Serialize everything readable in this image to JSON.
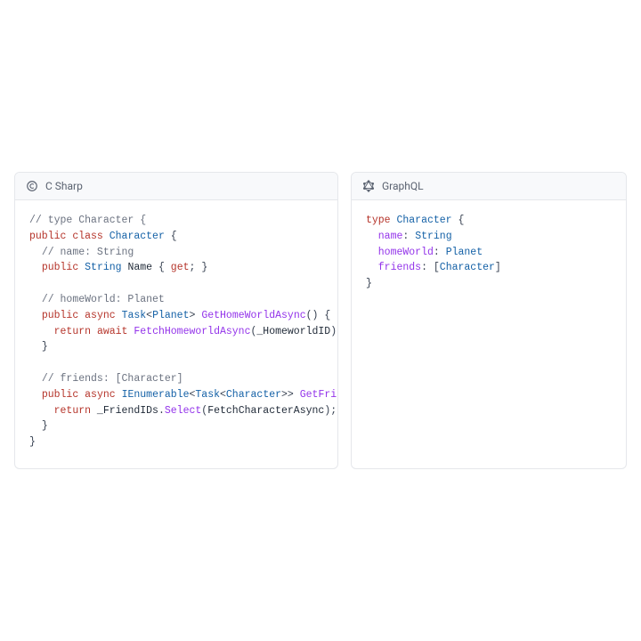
{
  "panels": {
    "left": {
      "title": "C Sharp",
      "icon": "csharp-icon",
      "code": [
        {
          "indent": 0,
          "tokens": [
            {
              "t": "comment",
              "v": "// type Character {"
            }
          ]
        },
        {
          "indent": 0,
          "tokens": [
            {
              "t": "keyword",
              "v": "public"
            },
            {
              "t": "space"
            },
            {
              "t": "keyword",
              "v": "class"
            },
            {
              "t": "space"
            },
            {
              "t": "type",
              "v": "Character"
            },
            {
              "t": "space"
            },
            {
              "t": "punc",
              "v": "{"
            }
          ]
        },
        {
          "indent": 1,
          "tokens": [
            {
              "t": "comment",
              "v": "// name: String"
            }
          ]
        },
        {
          "indent": 1,
          "tokens": [
            {
              "t": "keyword",
              "v": "public"
            },
            {
              "t": "space"
            },
            {
              "t": "type",
              "v": "String"
            },
            {
              "t": "space"
            },
            {
              "t": "plain",
              "v": "Name"
            },
            {
              "t": "space"
            },
            {
              "t": "punc",
              "v": "{"
            },
            {
              "t": "space"
            },
            {
              "t": "keyword",
              "v": "get"
            },
            {
              "t": "punc",
              "v": ";"
            },
            {
              "t": "space"
            },
            {
              "t": "punc",
              "v": "}"
            }
          ]
        },
        {
          "indent": 0,
          "tokens": []
        },
        {
          "indent": 1,
          "tokens": [
            {
              "t": "comment",
              "v": "// homeWorld: Planet"
            }
          ]
        },
        {
          "indent": 1,
          "tokens": [
            {
              "t": "keyword",
              "v": "public"
            },
            {
              "t": "space"
            },
            {
              "t": "keyword",
              "v": "async"
            },
            {
              "t": "space"
            },
            {
              "t": "type",
              "v": "Task"
            },
            {
              "t": "punc",
              "v": "<"
            },
            {
              "t": "type",
              "v": "Planet"
            },
            {
              "t": "punc",
              "v": ">"
            },
            {
              "t": "space"
            },
            {
              "t": "func",
              "v": "GetHomeWorldAsync"
            },
            {
              "t": "punc",
              "v": "()"
            },
            {
              "t": "space"
            },
            {
              "t": "punc",
              "v": "{"
            }
          ]
        },
        {
          "indent": 2,
          "tokens": [
            {
              "t": "keyword",
              "v": "return"
            },
            {
              "t": "space"
            },
            {
              "t": "keyword",
              "v": "await"
            },
            {
              "t": "space"
            },
            {
              "t": "func",
              "v": "FetchHomeworldAsync"
            },
            {
              "t": "punc",
              "v": "("
            },
            {
              "t": "plain",
              "v": "_HomeworldID"
            },
            {
              "t": "punc",
              "v": ")"
            }
          ]
        },
        {
          "indent": 1,
          "tokens": [
            {
              "t": "punc",
              "v": "}"
            }
          ]
        },
        {
          "indent": 0,
          "tokens": []
        },
        {
          "indent": 1,
          "tokens": [
            {
              "t": "comment",
              "v": "// friends: [Character]"
            }
          ]
        },
        {
          "indent": 1,
          "tokens": [
            {
              "t": "keyword",
              "v": "public"
            },
            {
              "t": "space"
            },
            {
              "t": "keyword",
              "v": "async"
            },
            {
              "t": "space"
            },
            {
              "t": "type",
              "v": "IEnumerable"
            },
            {
              "t": "punc",
              "v": "<"
            },
            {
              "t": "type",
              "v": "Task"
            },
            {
              "t": "punc",
              "v": "<"
            },
            {
              "t": "type",
              "v": "Character"
            },
            {
              "t": "punc",
              "v": ">>"
            },
            {
              "t": "space"
            },
            {
              "t": "func",
              "v": "GetFri"
            }
          ]
        },
        {
          "indent": 2,
          "tokens": [
            {
              "t": "keyword",
              "v": "return"
            },
            {
              "t": "space"
            },
            {
              "t": "plain",
              "v": "_FriendIDs"
            },
            {
              "t": "punc",
              "v": "."
            },
            {
              "t": "func",
              "v": "Select"
            },
            {
              "t": "punc",
              "v": "("
            },
            {
              "t": "plain",
              "v": "FetchCharacterAsync"
            },
            {
              "t": "punc",
              "v": ");"
            }
          ]
        },
        {
          "indent": 1,
          "tokens": [
            {
              "t": "punc",
              "v": "}"
            }
          ]
        },
        {
          "indent": 0,
          "tokens": [
            {
              "t": "punc",
              "v": "}"
            }
          ]
        }
      ]
    },
    "right": {
      "title": "GraphQL",
      "icon": "graphql-icon",
      "code": [
        {
          "indent": 0,
          "tokens": [
            {
              "t": "keyword",
              "v": "type"
            },
            {
              "t": "space"
            },
            {
              "t": "type",
              "v": "Character"
            },
            {
              "t": "space"
            },
            {
              "t": "punc",
              "v": "{"
            }
          ]
        },
        {
          "indent": 1,
          "tokens": [
            {
              "t": "field",
              "v": "name"
            },
            {
              "t": "punc",
              "v": ":"
            },
            {
              "t": "space"
            },
            {
              "t": "type",
              "v": "String"
            }
          ]
        },
        {
          "indent": 1,
          "tokens": [
            {
              "t": "field",
              "v": "homeWorld"
            },
            {
              "t": "punc",
              "v": ":"
            },
            {
              "t": "space"
            },
            {
              "t": "type",
              "v": "Planet"
            }
          ]
        },
        {
          "indent": 1,
          "tokens": [
            {
              "t": "field",
              "v": "friends"
            },
            {
              "t": "punc",
              "v": ":"
            },
            {
              "t": "space"
            },
            {
              "t": "punc",
              "v": "["
            },
            {
              "t": "type",
              "v": "Character"
            },
            {
              "t": "punc",
              "v": "]"
            }
          ]
        },
        {
          "indent": 0,
          "tokens": [
            {
              "t": "punc",
              "v": "}"
            }
          ]
        }
      ]
    }
  }
}
